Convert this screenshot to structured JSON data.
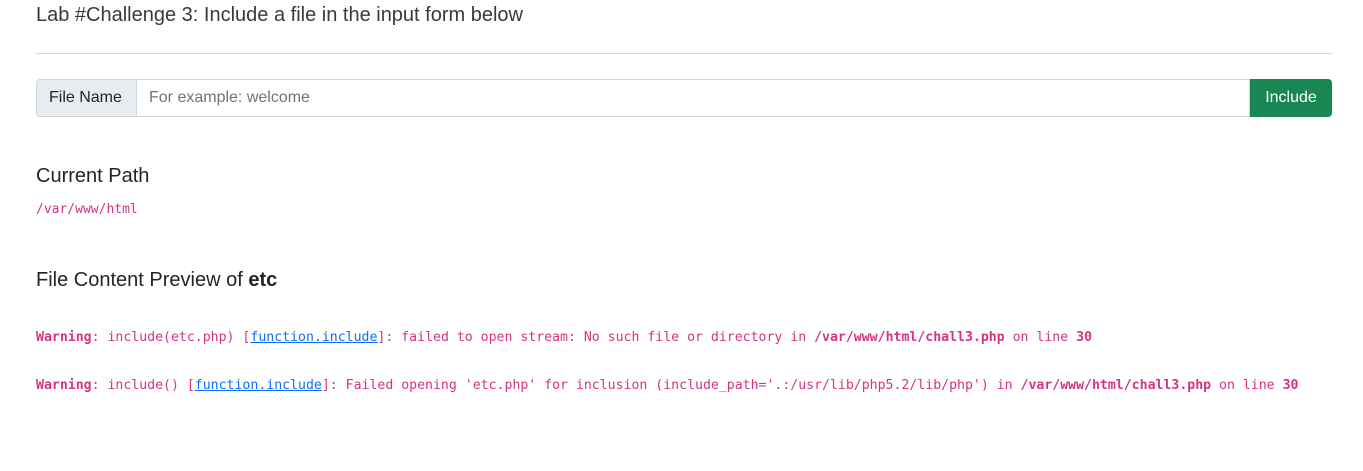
{
  "header": {
    "title": "Lab #Challenge 3: Include a file in the input form below"
  },
  "form": {
    "addon_label": "File Name",
    "input_value": "",
    "input_placeholder": "For example: welcome",
    "submit_label": "Include"
  },
  "current_path": {
    "heading": "Current Path",
    "value": "/var/www/html"
  },
  "preview": {
    "heading_prefix": "File Content Preview of ",
    "heading_file": "etc"
  },
  "warnings": [
    {
      "label": "Warning",
      "text_before": ": include(etc.php) [",
      "link": "function.include",
      "text_after": "]: failed to open stream: No such file or directory in ",
      "file": "/var/www/html/chall3.php",
      "on_line": " on line ",
      "line": "30"
    },
    {
      "label": "Warning",
      "text_before": ": include() [",
      "link": "function.include",
      "text_after": "]: Failed opening 'etc.php' for inclusion (include_path='.:/usr/lib/php5.2/lib/php') in ",
      "file": "/var/www/html/chall3.php",
      "on_line": " on line ",
      "line": "30"
    }
  ],
  "colors": {
    "accent_button": "#198754",
    "code_pink": "#d63384",
    "link_blue": "#0d6efd"
  }
}
